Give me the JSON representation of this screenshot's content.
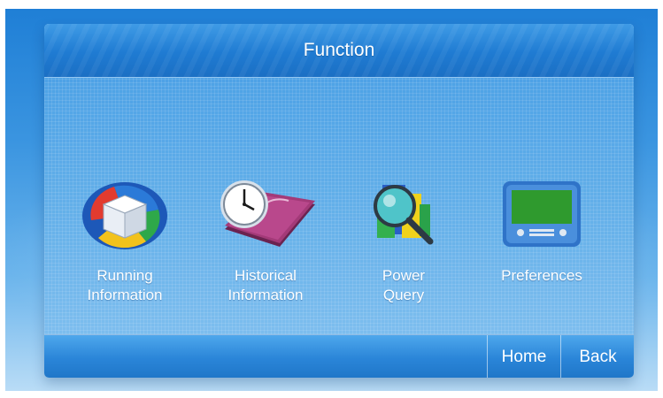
{
  "title": "Function",
  "functions": [
    {
      "line1": "Running",
      "line2": "Information",
      "icon": "running-info-cube-icon"
    },
    {
      "line1": "Historical",
      "line2": "Information",
      "icon": "history-clock-book-icon"
    },
    {
      "line1": "Power",
      "line2": "Query",
      "icon": "magnifier-query-icon"
    },
    {
      "line1": "Preferences",
      "line2": "",
      "icon": "monitor-settings-icon"
    }
  ],
  "nav": {
    "home": "Home",
    "back": "Back"
  }
}
